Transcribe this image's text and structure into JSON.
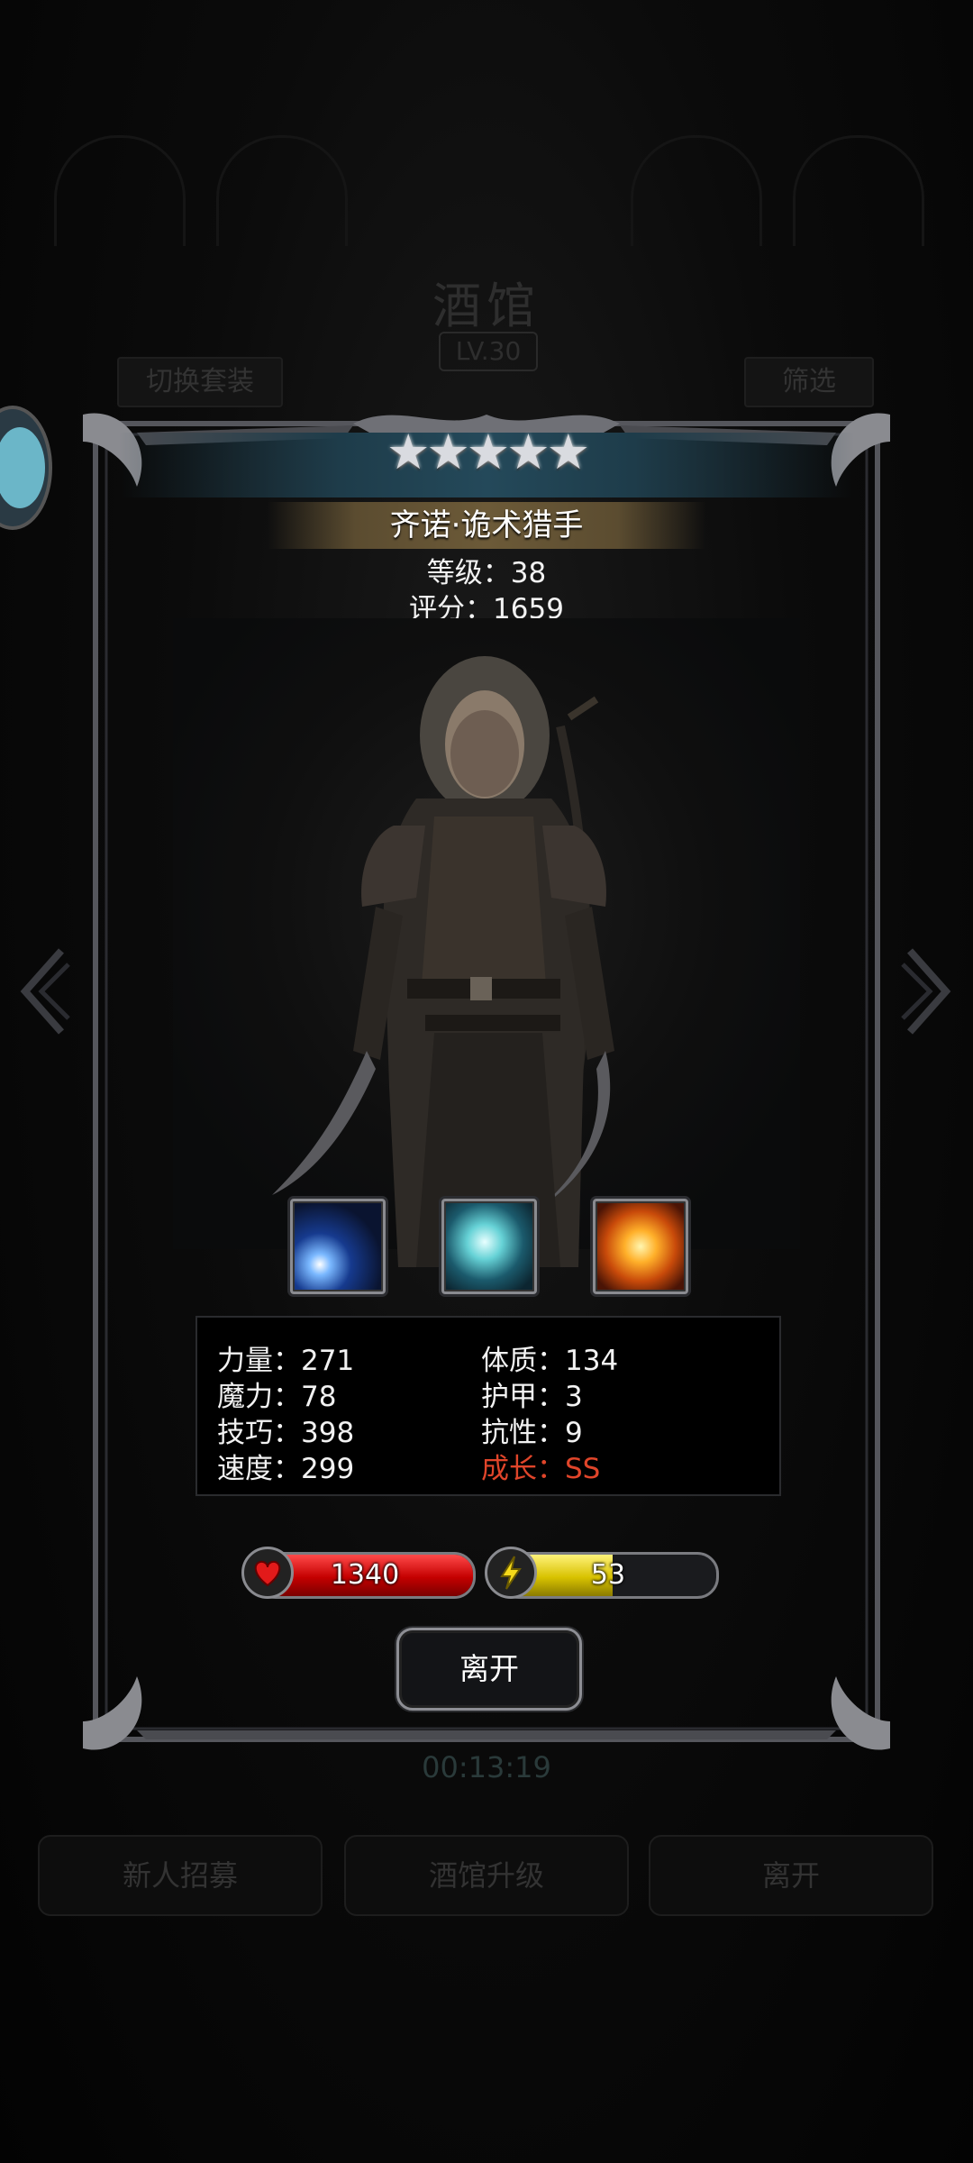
{
  "background": {
    "title": "酒馆",
    "level": "LV.30",
    "switch_set_label": "切换套装",
    "filter_label": "筛选",
    "timer": "00:13:19",
    "buttons": {
      "recruit": "新人招募",
      "upgrade": "酒馆升级",
      "leave": "离开"
    }
  },
  "hero": {
    "stars": 5,
    "star_glyphs": "★★★★★",
    "name": "齐诺·诡术猎手",
    "level_text": "等级：38",
    "score_text": "评分：1659",
    "skills": [
      {
        "icon": "light-beam-skill-icon"
      },
      {
        "icon": "whirlwind-skill-icon"
      },
      {
        "icon": "fire-explosion-skill-icon"
      }
    ],
    "stats": [
      {
        "text": "力量：271"
      },
      {
        "text": "体质：134"
      },
      {
        "text": "魔力：78"
      },
      {
        "text": "护甲：3"
      },
      {
        "text": "技巧：398"
      },
      {
        "text": "抗性：9"
      },
      {
        "text": "速度：299"
      },
      {
        "text": "成长：SS",
        "color": "#e0452a"
      }
    ],
    "hp": {
      "value": "1340",
      "fill": 1.0,
      "icon": "heart-icon",
      "color": "#c40000"
    },
    "energy": {
      "value": "53",
      "fill": 0.52,
      "icon": "lightning-icon",
      "color": "#d8c200"
    },
    "leave_label": "离开"
  }
}
